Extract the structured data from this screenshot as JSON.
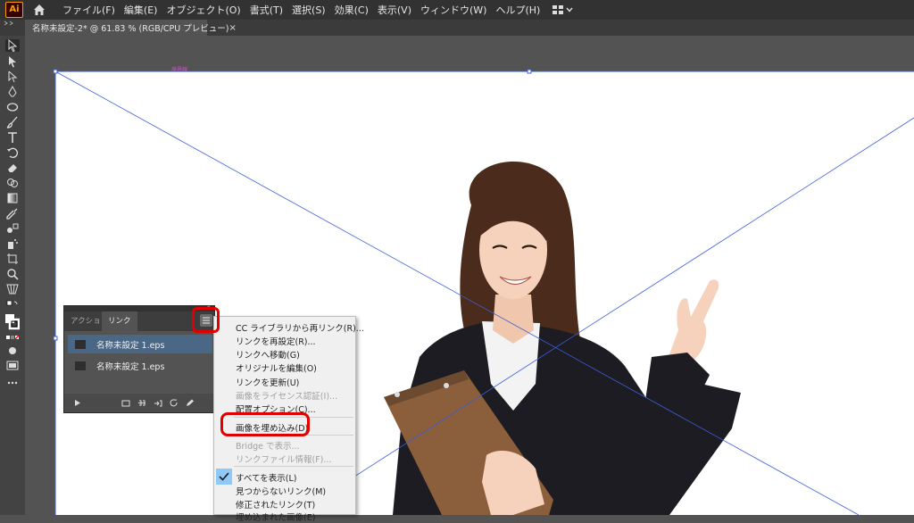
{
  "app": {
    "logo_text": "Ai"
  },
  "menubar": {
    "items": [
      "ファイル(F)",
      "編集(E)",
      "オブジェクト(O)",
      "書式(T)",
      "選択(S)",
      "効果(C)",
      "表示(V)",
      "ウィンドウ(W)",
      "ヘルプ(H)"
    ]
  },
  "document_tab": {
    "title": "名称未設定-2* @ 61.83 % (RGB/CPU プレビュー)",
    "close": "×"
  },
  "canvas": {
    "artboard_label": "境界線"
  },
  "links_panel": {
    "tabs": [
      "アクション",
      "リンク"
    ],
    "rows": [
      "名称未設定 1.eps",
      "名称未設定 1.eps"
    ]
  },
  "context_menu": {
    "items": [
      {
        "label": "CC ライブラリから再リンク(R)...",
        "disabled": false
      },
      {
        "label": "リンクを再設定(R)...",
        "disabled": false
      },
      {
        "label": "リンクへ移動(G)",
        "disabled": false
      },
      {
        "label": "オリジナルを編集(O)",
        "disabled": false
      },
      {
        "label": "リンクを更新(U)",
        "disabled": false
      },
      {
        "label": "画像をライセンス認証(I)...",
        "disabled": true
      },
      {
        "label": "配置オプション(C)...",
        "disabled": false
      },
      {
        "label": "画像を埋め込み(D)",
        "disabled": false
      },
      {
        "label": "Bridge で表示...",
        "disabled": true
      },
      {
        "label": "リンクファイル情報(F)...",
        "disabled": true
      },
      {
        "label": "すべてを表示(L)",
        "disabled": false,
        "checked": true
      },
      {
        "label": "見つからないリンク(M)",
        "disabled": false
      },
      {
        "label": "修正されたリンク(T)",
        "disabled": false
      },
      {
        "label": "埋め込まれた画像(E)",
        "disabled": false
      }
    ]
  },
  "colors": {
    "highlight": "#e00000",
    "selected_row": "#4a6786",
    "guide_line": "#3a5fd6"
  }
}
